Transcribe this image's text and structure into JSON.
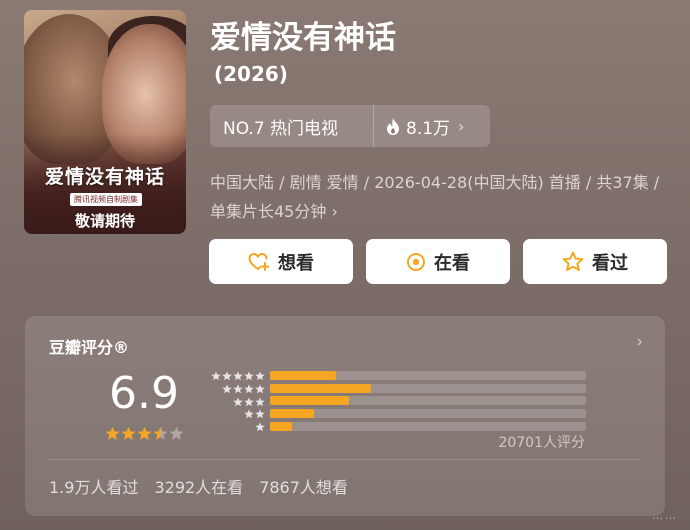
{
  "poster": {
    "title": "爱情没有神话",
    "tag": "腾讯视频自制剧集",
    "subtitle": "敬请期待"
  },
  "show": {
    "title": "爱情没有神话",
    "year": "(2026)"
  },
  "rank": {
    "label": "NO.7 热门电视",
    "heat": "8.1万",
    "icon": "flame-icon"
  },
  "info": {
    "text": "中国大陆 / 剧情 爱情 / 2026-04-28(中国大陆) 首播 / 共37集 / 单集片长45分钟",
    "chevron": "›"
  },
  "actions": [
    {
      "label": "想看",
      "icon": "heart-plus-icon"
    },
    {
      "label": "在看",
      "icon": "target-icon"
    },
    {
      "label": "看过",
      "icon": "star-icon"
    }
  ],
  "rating": {
    "header": "豆瓣评分®",
    "score": "6.9",
    "stars_value": 3.5,
    "distribution": [
      {
        "stars": 5,
        "fraction": 0.21
      },
      {
        "stars": 4,
        "fraction": 0.32
      },
      {
        "stars": 3,
        "fraction": 0.25
      },
      {
        "stars": 2,
        "fraction": 0.14
      },
      {
        "stars": 1,
        "fraction": 0.07
      }
    ],
    "count": "20701人评分",
    "stats": [
      "1.9万人看过",
      "3292人在看",
      "7867人想看"
    ]
  },
  "colors": {
    "accent": "#f5a623",
    "background": "#7f6f6a"
  },
  "watermark": "……"
}
